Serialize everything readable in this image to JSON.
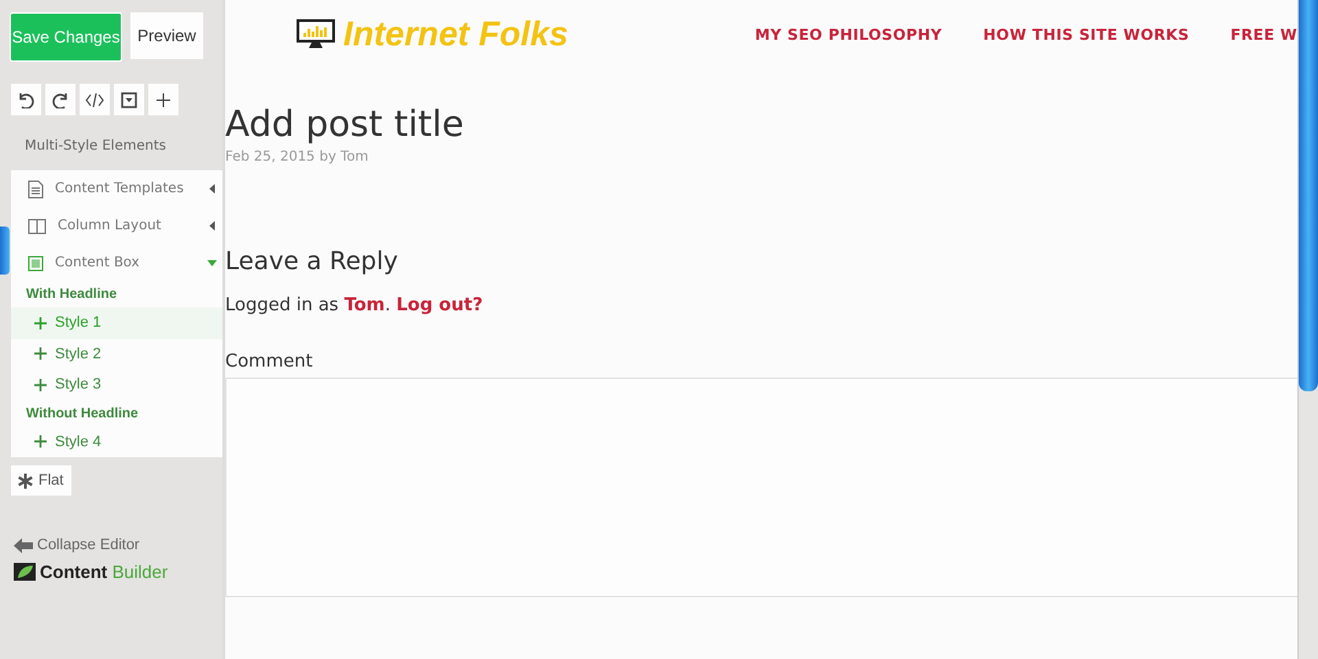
{
  "editor": {
    "save_button": "Save Changes",
    "preview_button": "Preview",
    "panel_title": "Multi-Style Elements",
    "categories": [
      {
        "label": "Content Templates",
        "expanded": false
      },
      {
        "label": "Column Layout",
        "expanded": false
      },
      {
        "label": "Content Box",
        "expanded": true,
        "groups": [
          {
            "heading": "With Headline",
            "styles": [
              {
                "label": "Style 1",
                "hovered": true
              },
              {
                "label": "Style 2",
                "hovered": false
              },
              {
                "label": "Style 3",
                "hovered": false
              }
            ]
          },
          {
            "heading": "Without Headline",
            "styles": [
              {
                "label": "Style 4",
                "hovered": false
              }
            ]
          }
        ]
      }
    ],
    "flat_button": "Flat",
    "collapse": "Collapse Editor",
    "brand": {
      "part_1": "Content",
      "part_2": "Builder"
    }
  },
  "site": {
    "logo": "Internet Folks",
    "nav": [
      "MY SEO PHILOSOPHY",
      "HOW THIS SITE WORKS",
      "FREE W"
    ],
    "post": {
      "title": "Add post title",
      "meta": "Feb 25, 2015 by Tom"
    },
    "reply": {
      "heading": "Leave a Reply",
      "logged_in_prefix": "Logged in as ",
      "user": "Tom",
      "separator": ".",
      "logout": "Log out?",
      "comment_label": "Comment"
    }
  }
}
